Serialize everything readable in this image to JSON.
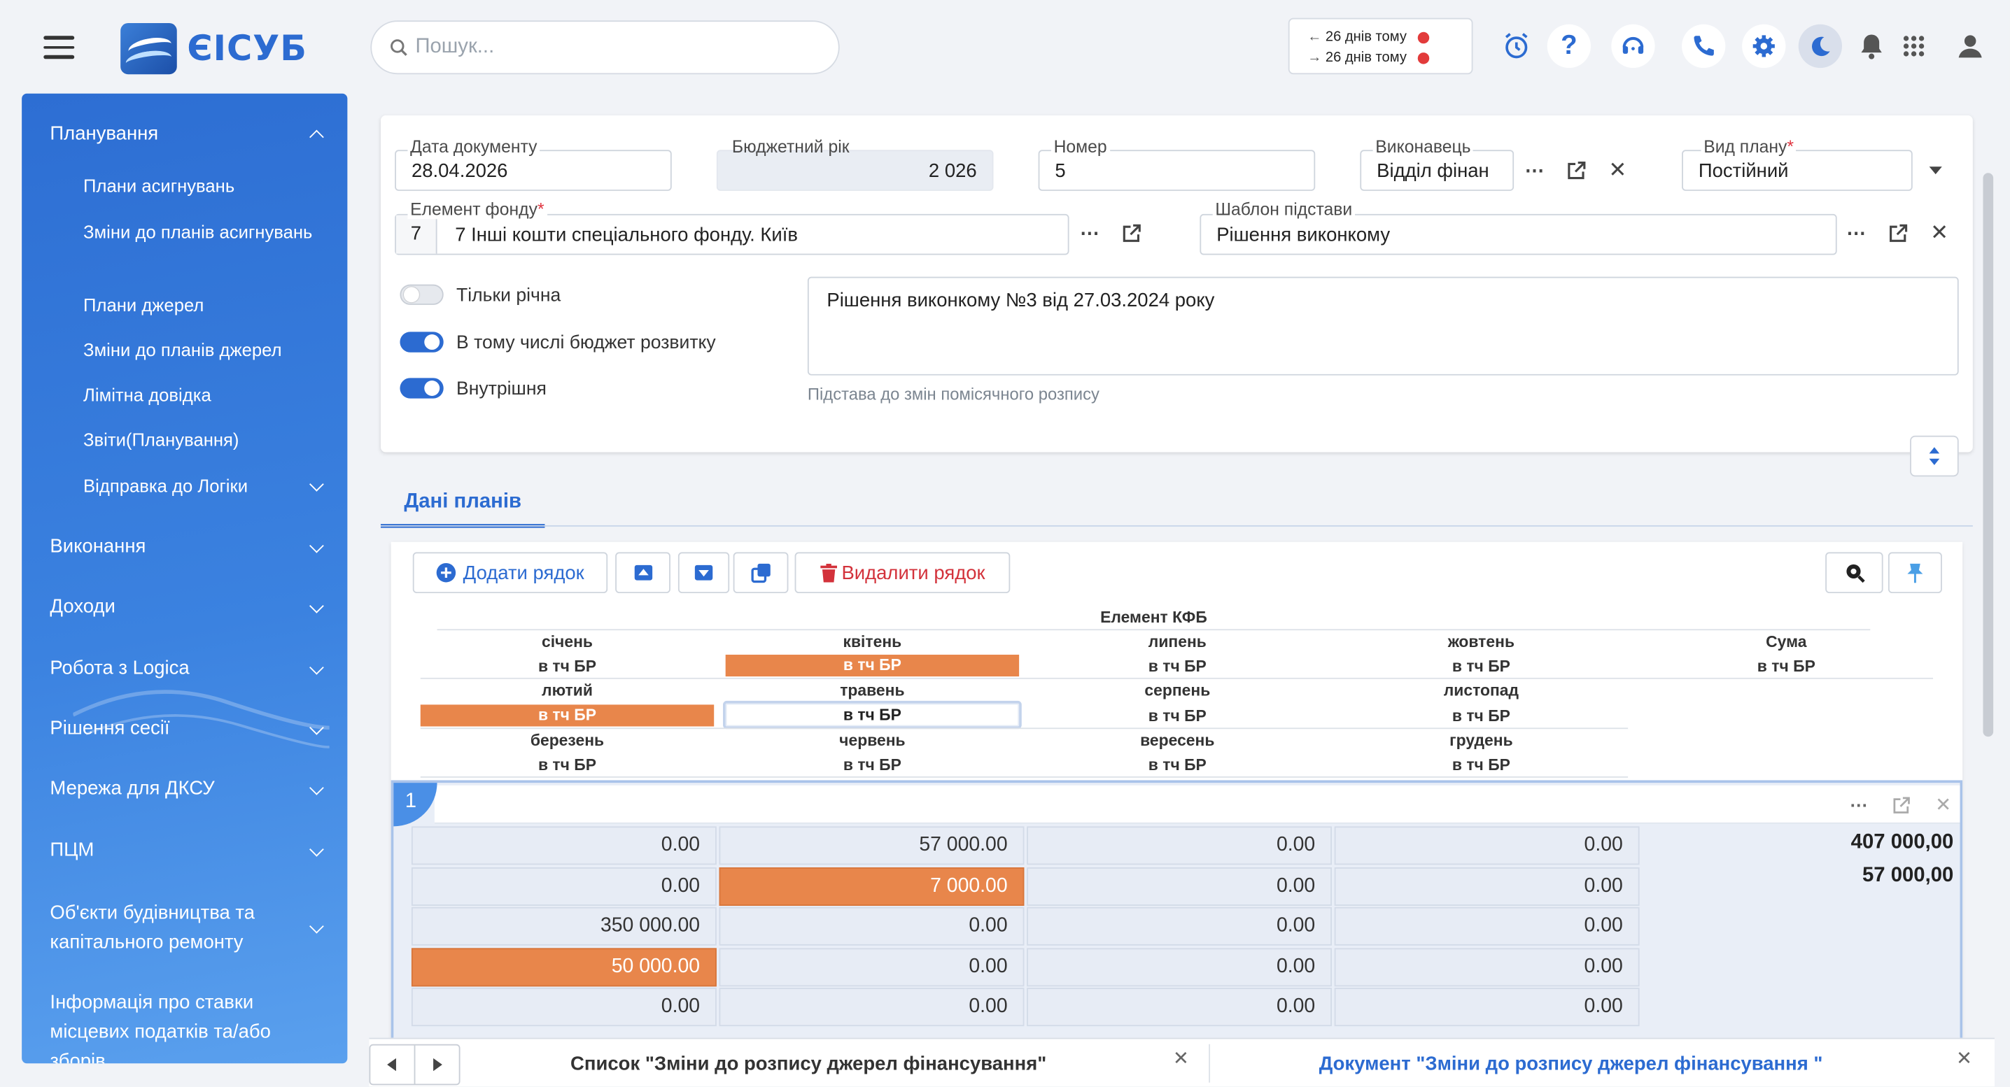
{
  "app": {
    "name": "ЄІСУБ"
  },
  "search": {
    "placeholder": "Пошук..."
  },
  "dates": {
    "prev": "26 днів тому",
    "next": "26 днів тому"
  },
  "top_icons": [
    "alarm-icon",
    "help-icon",
    "support-icon",
    "phone-icon",
    "settings-icon",
    "moon-icon",
    "bell-icon",
    "apps-icon",
    "user-icon"
  ],
  "sidebar": {
    "sections": [
      {
        "label": "Планування",
        "expanded": true
      },
      {
        "label": "Виконання"
      },
      {
        "label": "Доходи"
      },
      {
        "label": "Робота з Logica"
      },
      {
        "label": "Рішення сесії"
      },
      {
        "label": "Мережа для ДКСУ"
      },
      {
        "label": "ПЦМ"
      },
      {
        "label": "Об'єкти будівництва та капітального ремонту"
      },
      {
        "label": "Інформація про ставки місцевих податків та/або зборів"
      }
    ],
    "items": [
      "Плани асигнувань",
      "Зміни до планів асигнувань",
      "Плани джерел",
      "Зміни до планів джерел",
      "Лімітна довідка",
      "Звіти(Планування)",
      "Відправка до Логіки"
    ]
  },
  "form": {
    "doc_date_label": "Дата документу",
    "doc_date": "28.04.2026",
    "budget_year_label": "Бюджетний рік",
    "budget_year": "2 026",
    "number_label": "Номер",
    "number": "5",
    "executor_label": "Виконавець",
    "executor": "Відділ фінан",
    "plan_type_label": "Вид плану",
    "plan_type": "Постійний",
    "fund_label": "Елемент фонду",
    "fund_code": "7",
    "fund_value": "7 Інші кошти спеціального фонду. Київ",
    "template_label": "Шаблон підстави",
    "template_value": "Рішення виконкому",
    "toggle_annual": "Тільки річна",
    "toggle_dev": "В тому числі бюджет розвитку",
    "toggle_internal": "Внутрішня",
    "basis_text": "Рішення виконкому №3 від 27.03.2024 року",
    "basis_hint": "Підстава до змін помісячного розпису",
    "required_mark": "*"
  },
  "tab": {
    "label": "Дані планів"
  },
  "toolbar": {
    "add": "Додати рядок",
    "delete": "Видалити рядок"
  },
  "grid": {
    "kfb": "Елемент КФБ",
    "months": [
      "січень",
      "квітень",
      "липень",
      "жовтень",
      "Сума",
      "лютий",
      "травень",
      "серпень",
      "листопад",
      "березень",
      "червень",
      "вересень",
      "грудень"
    ],
    "br": "в тч БР",
    "row_num": "1",
    "cells": [
      [
        "0.00",
        "57 000.00",
        "0.00",
        "0.00"
      ],
      [
        "0.00",
        "7 000.00",
        "0.00",
        "0.00"
      ],
      [
        "350 000.00",
        "0.00",
        "0.00",
        "0.00"
      ],
      [
        "50 000.00",
        "0.00",
        "0.00",
        "0.00"
      ],
      [
        "0.00",
        "0.00",
        "0.00",
        "0.00"
      ]
    ],
    "sum": "407 000,00",
    "sum_br": "57 000,00"
  },
  "bottom": {
    "tab1": "Список \"Зміни до розпису джерел фінансування\"",
    "tab2": "Документ \"Зміни до розпису джерел фінансування \""
  },
  "colors": {
    "accent": "#2c6bd1",
    "highlight": "#e8864b",
    "danger": "#d3323b"
  }
}
